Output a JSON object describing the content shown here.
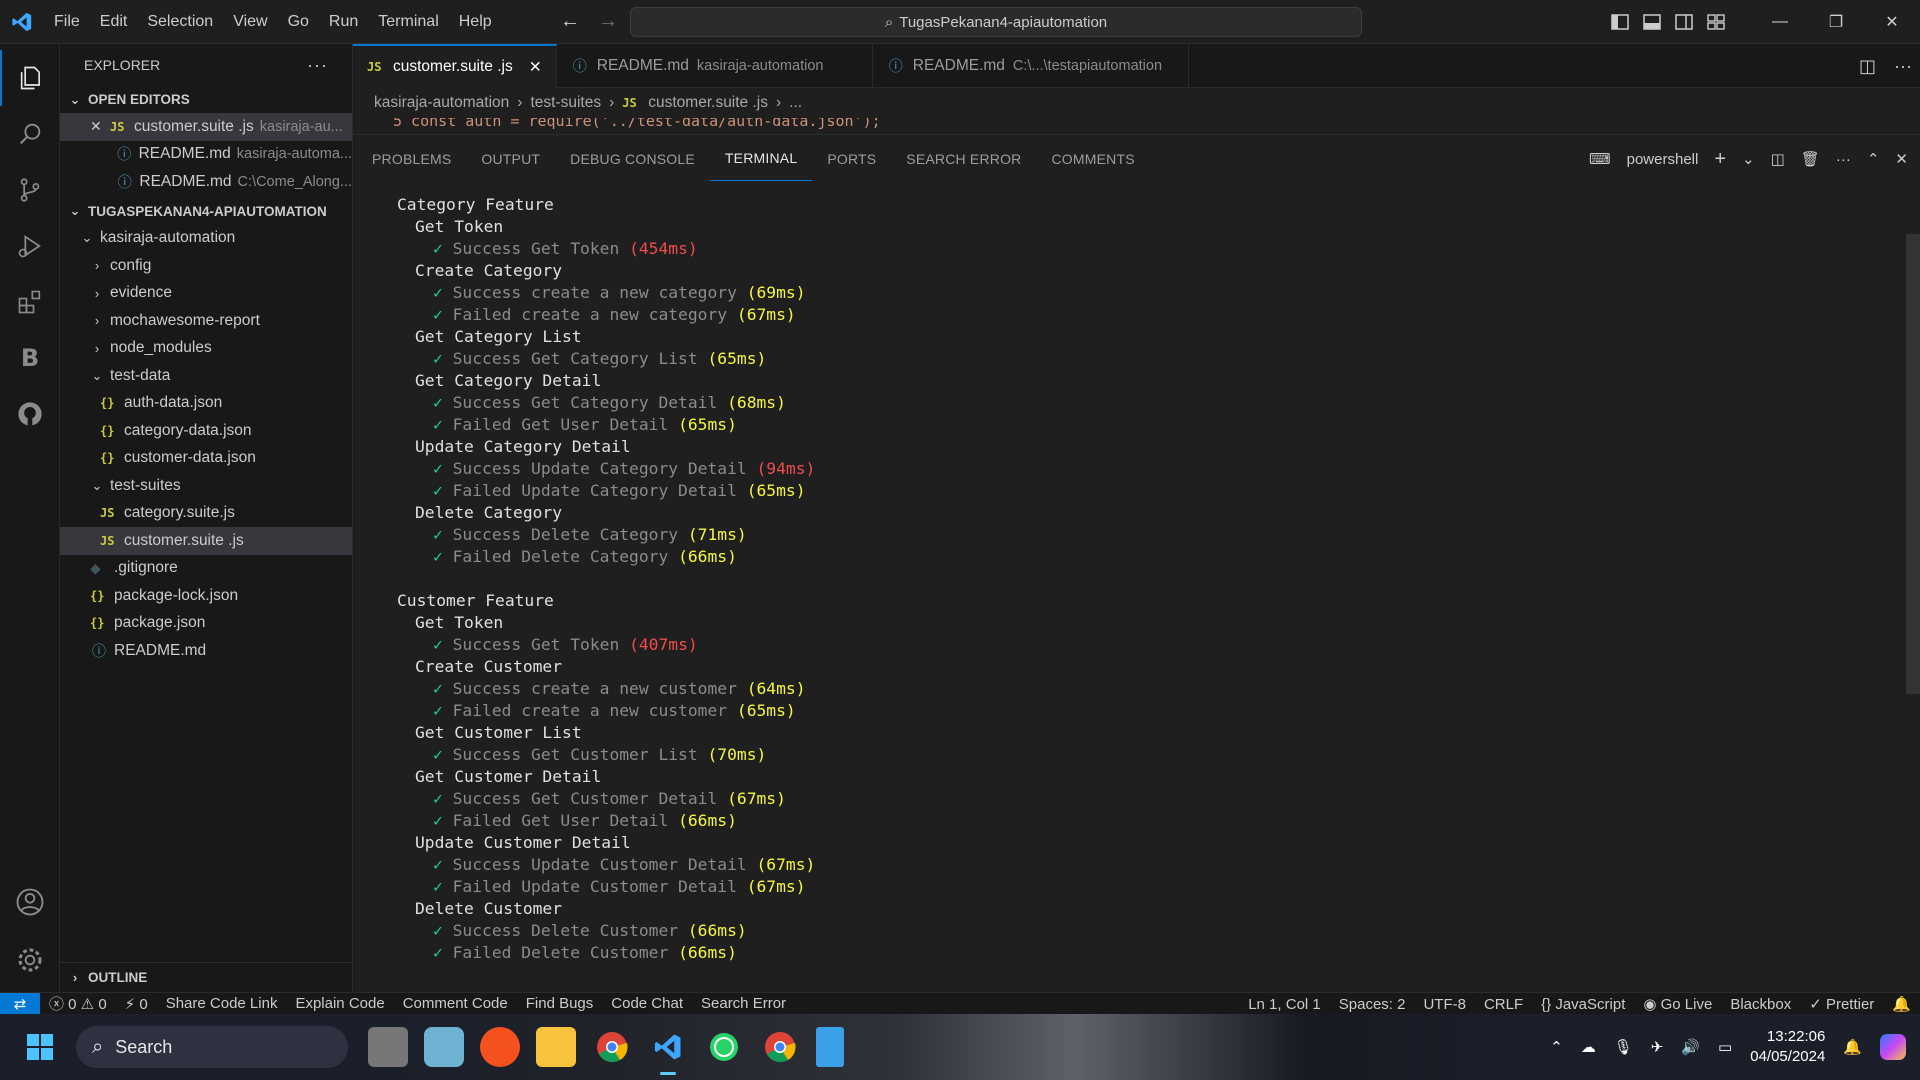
{
  "titlebar": {
    "menu": [
      "File",
      "Edit",
      "Selection",
      "View",
      "Go",
      "Run",
      "Terminal",
      "Help"
    ],
    "command_center": "TugasPekanan4-apiautomation"
  },
  "sidebar": {
    "title": "EXPLORER",
    "open_editors_label": "OPEN EDITORS",
    "open_editors": [
      {
        "name": "customer.suite .js",
        "desc": "kasiraja-au..."
      },
      {
        "name": "README.md",
        "desc": "kasiraja-automa..."
      },
      {
        "name": "README.md",
        "desc": "C:\\Come_Along..."
      }
    ],
    "workspace_label": "TUGASPEKANAN4-APIAUTOMATION",
    "tree": {
      "root": "kasiraja-automation",
      "folders": [
        "config",
        "evidence",
        "mochawesome-report",
        "node_modules"
      ],
      "test_data": "test-data",
      "test_data_files": [
        "auth-data.json",
        "category-data.json",
        "customer-data.json"
      ],
      "test_suites": "test-suites",
      "test_suites_files": [
        "category.suite.js",
        "customer.suite .js"
      ],
      "root_files": [
        ".gitignore",
        "package-lock.json",
        "package.json",
        "README.md"
      ]
    },
    "outline_label": "OUTLINE"
  },
  "editor": {
    "tabs": [
      {
        "name": "customer.suite .js",
        "desc": ""
      },
      {
        "name": "README.md",
        "desc": "kasiraja-automation"
      },
      {
        "name": "README.md",
        "desc": "C:\\...\\testapiautomation"
      }
    ],
    "breadcrumb": [
      "kasiraja-automation",
      "test-suites",
      "customer.suite .js",
      "..."
    ],
    "code_peek": "5    const auth = require('../test-data/auth-data.json');"
  },
  "panel": {
    "tabs": [
      "PROBLEMS",
      "OUTPUT",
      "DEBUG CONSOLE",
      "TERMINAL",
      "PORTS",
      "SEARCH ERROR",
      "COMMENTS"
    ],
    "shell": "powershell"
  },
  "terminal": {
    "category": {
      "title": "Category Feature",
      "g1": "Get Token",
      "t1": "Success Get Token",
      "t1ms": "(454ms)",
      "g2": "Create Category",
      "t2": "Success create a new category",
      "t2ms": "(69ms)",
      "t3": "Failed create a new category",
      "t3ms": "(67ms)",
      "g3": "Get Category List",
      "t4": "Success Get Category List",
      "t4ms": "(65ms)",
      "g4": "Get Category Detail",
      "t5": "Success Get Category Detail",
      "t5ms": "(68ms)",
      "t6": "Failed Get User Detail",
      "t6ms": "(65ms)",
      "g5": "Update Category Detail",
      "t7": "Success Update Category Detail",
      "t7ms": "(94ms)",
      "t8": "Failed Update Category Detail",
      "t8ms": "(65ms)",
      "g6": "Delete Category",
      "t9": "Success Delete Category",
      "t9ms": "(71ms)",
      "t10": "Failed Delete Category",
      "t10ms": "(66ms)"
    },
    "customer": {
      "title": "Customer Feature",
      "g1": "Get Token",
      "t1": "Success Get Token",
      "t1ms": "(407ms)",
      "g2": "Create Customer",
      "t2": "Success create a new customer",
      "t2ms": "(64ms)",
      "t3": "Failed create a new customer",
      "t3ms": "(65ms)",
      "g3": "Get Customer List",
      "t4": "Success Get Customer List",
      "t4ms": "(70ms)",
      "g4": "Get Customer Detail",
      "t5": "Success Get Customer Detail",
      "t5ms": "(67ms)",
      "t6": "Failed Get User Detail",
      "t6ms": "(66ms)",
      "g5": "Update Customer Detail",
      "t7": "Success Update Customer Detail",
      "t7ms": "(67ms)",
      "t8": "Failed Update Customer Detail",
      "t8ms": "(67ms)",
      "g6": "Delete Customer",
      "t9": "Success Delete Customer",
      "t9ms": "(66ms)",
      "t10": "Failed Delete Customer",
      "t10ms": "(66ms)"
    }
  },
  "statusbar": {
    "errors": "0",
    "warnings": "0",
    "ports": "0",
    "left": [
      "Share Code Link",
      "Explain Code",
      "Comment Code",
      "Find Bugs",
      "Code Chat",
      "Search Error"
    ],
    "position": "Ln 1, Col 1",
    "spaces": "Spaces: 2",
    "encoding": "UTF-8",
    "eol": "CRLF",
    "language": "JavaScript",
    "golive": "Go Live",
    "blackbox": "Blackbox",
    "prettier": "Prettier"
  },
  "taskbar": {
    "search": "Search",
    "time": "13:22:06",
    "date": "04/05/2024"
  },
  "colors": {
    "accent": "#0078d4",
    "pass": "#23d18b",
    "slow": "#f14c4c",
    "medium": "#f5f543"
  }
}
